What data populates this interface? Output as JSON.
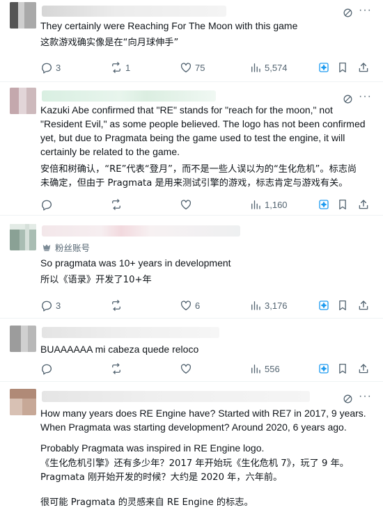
{
  "posts": [
    {
      "lines_en": [
        "They certainly were Reaching For The Moon with this game"
      ],
      "lines_cn": [
        "这款游戏确实像是在“向月球伸手”"
      ],
      "replies": "3",
      "reposts": "1",
      "likes": "75",
      "views": "5,574"
    },
    {
      "lines_en": [
        "Kazuki Abe confirmed that \"RE\" stands for \"reach for the moon,\" not",
        "\"Resident Evil,\" as some people believed. The logo has not been confirmed",
        "yet, but due to Pragmata being the game used to test the engine, it will",
        "certainly be related to the game."
      ],
      "lines_cn": [
        "安倍和树确认，“RE”代表“登月”，而不是一些人误以为的“生化危机”。标志尚",
        "未确定，但由于 Pragmata 是用来测试引擎的游戏，标志肯定与游戏有关。"
      ],
      "replies": "",
      "reposts": "",
      "likes": "",
      "views": "1,160"
    },
    {
      "badge": "粉丝账号",
      "lines_en": [
        "So pragmata was 10+ years in development"
      ],
      "lines_cn": [
        "所以《语录》开发了10+年"
      ],
      "replies": "3",
      "reposts": "",
      "likes": "6",
      "views": "3,176"
    },
    {
      "lines_en": [
        "BUAAAAAA mi cabeza quede reloco"
      ],
      "replies": "",
      "reposts": "",
      "likes": "",
      "views": "556"
    },
    {
      "lines_en": [
        "How many years does RE Engine have? Started with RE7 in 2017, 9 years.",
        "When Pragmata was starting development? Around 2020, 6 years ago."
      ],
      "lines_en2": [
        "Probably Pragmata was inspired in RE Engine logo."
      ],
      "lines_cn": [
        "《生化危机引擎》还有多少年？2017 年开始玩《生化危机 7》，玩了 9 年。",
        "Pragmata 刚开始开发的时候？大约是 2020 年，六年前。"
      ],
      "lines_cn2": [
        "很可能 Pragmata 的灵感来自 RE Engine 的标志。"
      ]
    }
  ],
  "icons": {
    "reply": "reply-icon",
    "repost": "repost-icon",
    "like": "like-icon",
    "views": "views-icon",
    "grok": "grok-icon",
    "bookmark": "bookmark-icon",
    "share": "share-icon",
    "more": "more-icon",
    "badge": "fan-account-icon"
  },
  "colors": {
    "accent": "#1d9bf0",
    "muted": "#536471",
    "text": "#0f1419",
    "divider": "#eff3f4"
  }
}
